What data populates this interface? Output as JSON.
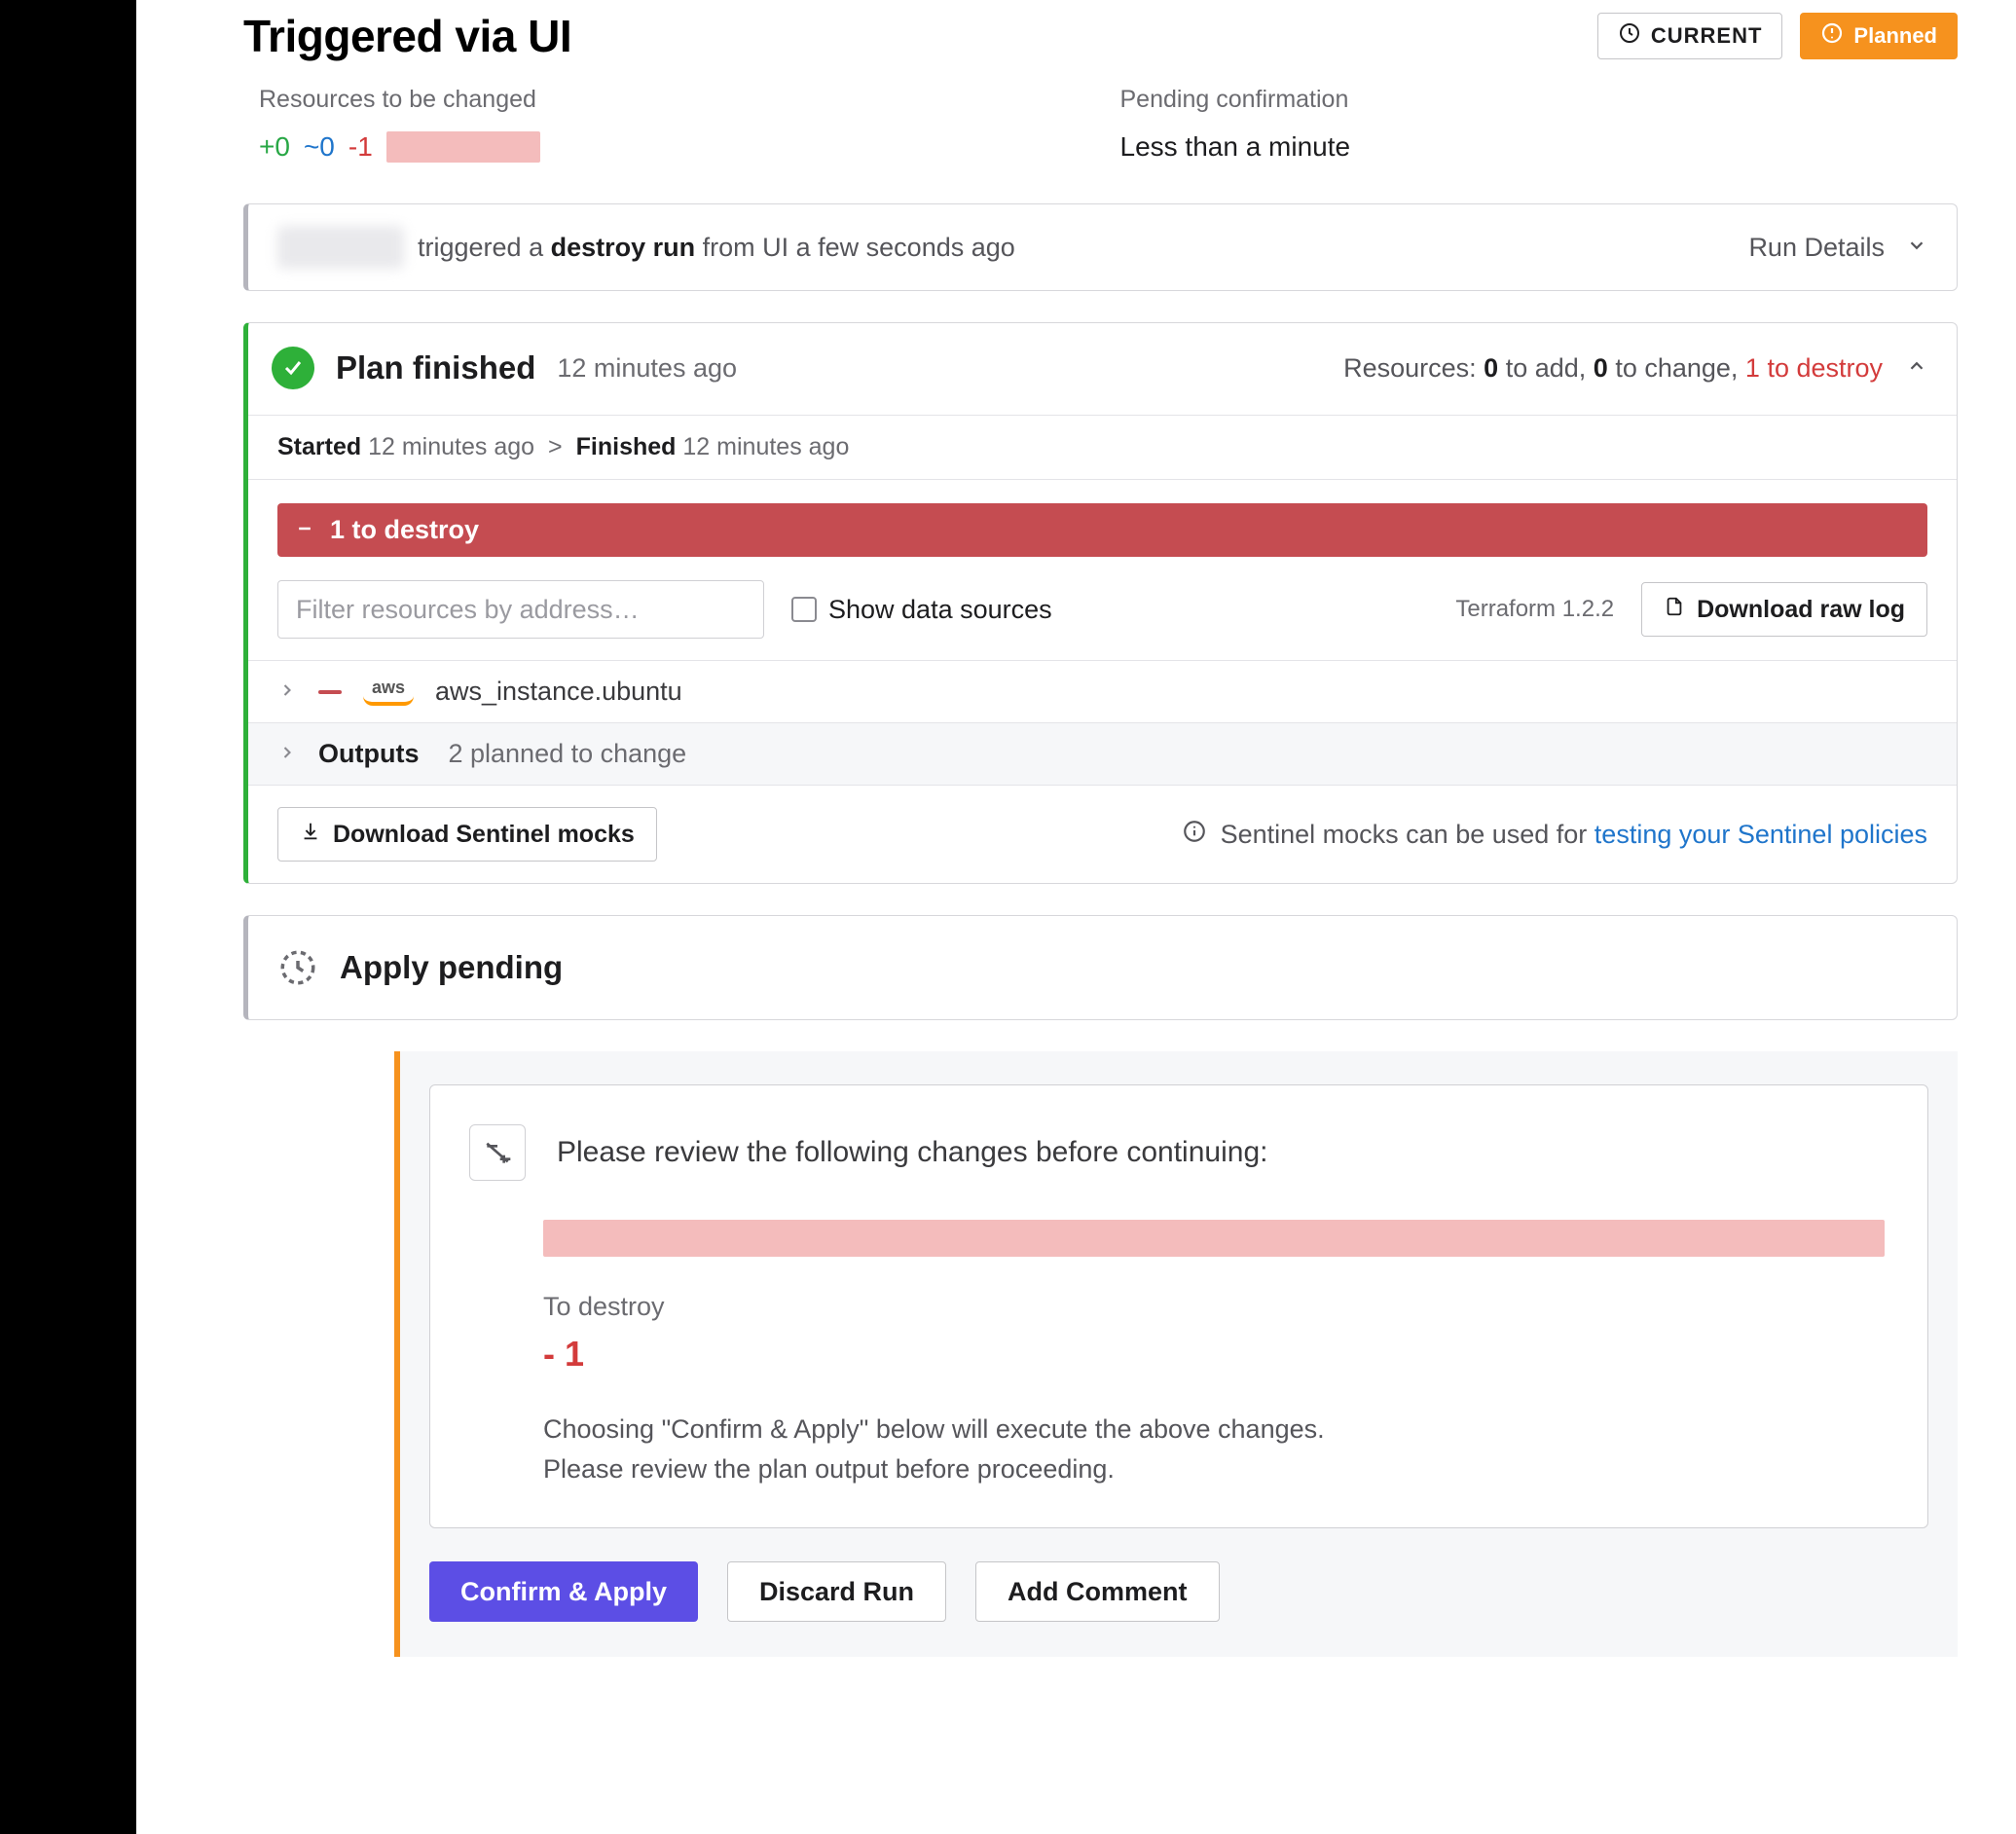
{
  "header": {
    "title": "Triggered via UI",
    "current_label": "CURRENT",
    "planned_label": "Planned"
  },
  "summary": {
    "resources_label": "Resources to be changed",
    "add": "+0",
    "change": "~0",
    "destroy": "-1",
    "pending_label": "Pending confirmation",
    "pending_value": "Less than a minute"
  },
  "trigger": {
    "text_prefix": "triggered a ",
    "text_strong": "destroy run",
    "text_suffix": " from UI a few seconds ago",
    "run_details": "Run Details"
  },
  "plan": {
    "title": "Plan finished",
    "time": "12 minutes ago",
    "resources_prefix": "Resources: ",
    "add_n": "0",
    "add_t": " to add, ",
    "change_n": "0",
    "change_t": " to change, ",
    "destroy_n": "1 to destroy",
    "started_label": "Started",
    "started_time": "12 minutes ago",
    "finished_label": "Finished",
    "finished_time": "12 minutes ago",
    "arrow": ">",
    "destroy_bar": "1 to destroy",
    "filter_placeholder": "Filter resources by address…",
    "show_data_sources": "Show data sources",
    "tf_version": "Terraform 1.2.2",
    "download_log": "Download raw log",
    "resource": "aws_instance.ubuntu",
    "aws_label": "aws",
    "outputs_label": "Outputs",
    "outputs_sub": "2 planned to change",
    "sentinel_btn": "Download Sentinel mocks",
    "sentinel_text": "Sentinel mocks can be used for ",
    "sentinel_link": "testing your Sentinel policies"
  },
  "apply": {
    "title": "Apply pending"
  },
  "confirm": {
    "heading": "Please review the following changes before continuing:",
    "to_destroy_label": "To destroy",
    "to_destroy_value": "- 1",
    "desc1": "Choosing \"Confirm & Apply\" below will execute the above changes.",
    "desc2": "Please review the plan output before proceeding.",
    "confirm_btn": "Confirm & Apply",
    "discard_btn": "Discard Run",
    "comment_btn": "Add Comment"
  }
}
